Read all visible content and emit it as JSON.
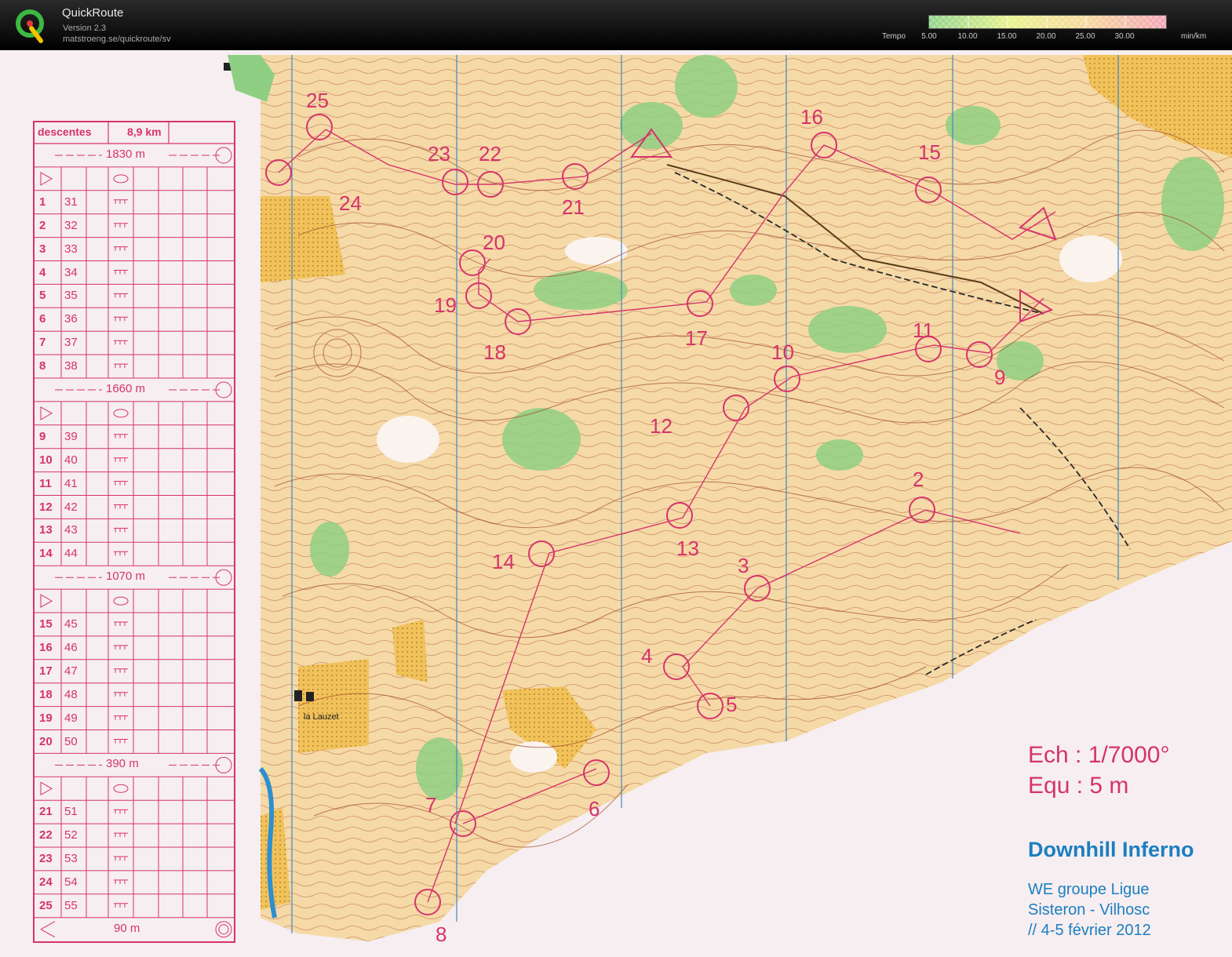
{
  "app": {
    "title": "QuickRoute",
    "version": "Version 2.3",
    "url": "matstroeng.se/quickroute/sv",
    "tempo_label": "Tempo",
    "tempo_unit": "min/km",
    "tempo_ticks": [
      "5.00",
      "10.00",
      "15.00",
      "20.00",
      "25.00",
      "30.00"
    ],
    "colors": {
      "logo_ring": "#3db843",
      "logo_accent": "#f4c400",
      "map_ink": "#d6336c",
      "legend_blue": "#1b7fc1"
    }
  },
  "description_sheet": {
    "course_name": "descentes",
    "course_length": "8,9 km",
    "sections": [
      {
        "distance": "1830 m",
        "controls": [
          {
            "n": "1",
            "code": "31"
          },
          {
            "n": "2",
            "code": "32"
          },
          {
            "n": "3",
            "code": "33"
          },
          {
            "n": "4",
            "code": "34"
          },
          {
            "n": "5",
            "code": "35"
          },
          {
            "n": "6",
            "code": "36"
          },
          {
            "n": "7",
            "code": "37"
          },
          {
            "n": "8",
            "code": "38"
          }
        ]
      },
      {
        "distance": "1660 m",
        "controls": [
          {
            "n": "9",
            "code": "39"
          },
          {
            "n": "10",
            "code": "40"
          },
          {
            "n": "11",
            "code": "41"
          },
          {
            "n": "12",
            "code": "42"
          },
          {
            "n": "13",
            "code": "43"
          },
          {
            "n": "14",
            "code": "44"
          }
        ]
      },
      {
        "distance": "1070 m",
        "controls": [
          {
            "n": "15",
            "code": "45"
          },
          {
            "n": "16",
            "code": "46"
          },
          {
            "n": "17",
            "code": "47"
          },
          {
            "n": "18",
            "code": "48"
          },
          {
            "n": "19",
            "code": "49"
          },
          {
            "n": "20",
            "code": "50"
          }
        ]
      },
      {
        "distance": "390 m",
        "controls": [
          {
            "n": "21",
            "code": "51"
          },
          {
            "n": "22",
            "code": "52"
          },
          {
            "n": "23",
            "code": "53"
          },
          {
            "n": "24",
            "code": "54"
          },
          {
            "n": "25",
            "code": "55"
          }
        ]
      }
    ],
    "finish_distance": "90 m"
  },
  "map": {
    "control_numbers": [
      "25",
      "23",
      "22",
      "24",
      "21",
      "20",
      "19",
      "18",
      "17",
      "16",
      "15",
      "11",
      "10",
      "9",
      "12",
      "2",
      "14",
      "13",
      "3",
      "4",
      "5",
      "7",
      "6",
      "8"
    ],
    "place_name": "la Lauzet",
    "scale": "Ech : 1/7000°",
    "equidistance": "Equ : 5 m",
    "event_title": "Downhill Inferno",
    "event_line1": "WE groupe Ligue",
    "event_line2": "Sisteron - Vilhosc",
    "event_line3": "// 4-5 février 2012"
  }
}
